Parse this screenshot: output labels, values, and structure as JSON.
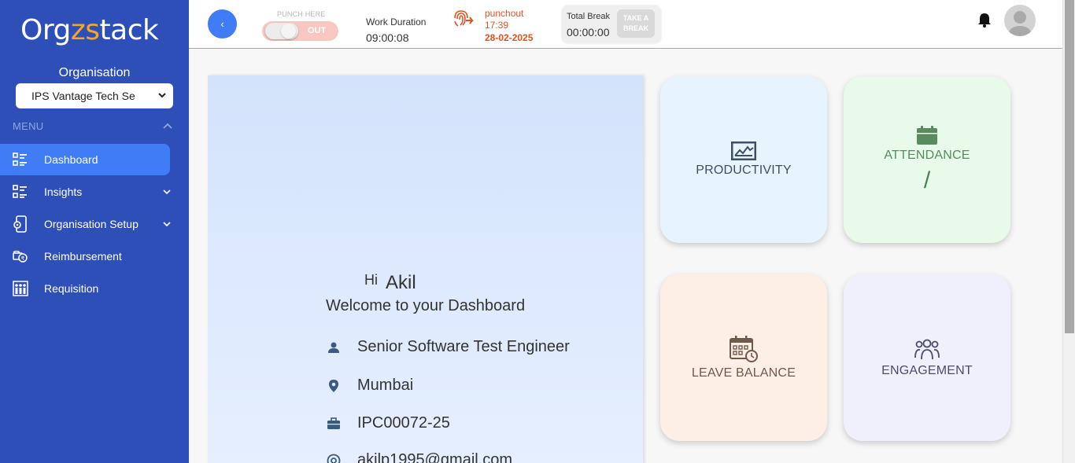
{
  "brand": {
    "logo_pre": "Org",
    "logo_accent": "zs",
    "logo_post": "tack"
  },
  "sidebar": {
    "org_label": "Organisation",
    "org_selected": "IPS Vantage Tech Se",
    "menu_label": "MENU",
    "items": [
      {
        "label": "Dashboard",
        "icon": "dashboard-icon",
        "active": true
      },
      {
        "label": "Insights",
        "icon": "insights-icon",
        "expandable": true
      },
      {
        "label": "Organisation Setup",
        "icon": "org-setup-icon",
        "expandable": true
      },
      {
        "label": "Reimbursement",
        "icon": "reimbursement-icon"
      },
      {
        "label": "Requisition",
        "icon": "requisition-icon"
      }
    ]
  },
  "header": {
    "back_icon": "‹",
    "punch_here_label": "PUNCH HERE",
    "toggle_label": "OUT",
    "work_duration_label": "Work Duration",
    "work_duration_value": "09:00:08",
    "punch_status": "punchout",
    "punch_time": "17:39",
    "punch_date": "28-02-2025",
    "total_break_label": "Total Break",
    "total_break_value": "00:00:00",
    "take_break_label": "TAKE A BREAK"
  },
  "welcome": {
    "hi": "Hi",
    "name": "Akil",
    "message": "Welcome to your Dashboard",
    "designation": "Senior Software Test Engineer",
    "location": "Mumbai",
    "employee_id": "IPC00072-25",
    "email": "akilp1995@gmail.com"
  },
  "tiles": {
    "productivity": "PRODUCTIVITY",
    "attendance": "ATTENDANCE",
    "attendance_value": "/",
    "leave_balance": "LEAVE BALANCE",
    "engagement": "ENGAGEMENT"
  },
  "colors": {
    "sidebar_bg": "#2f4fb8",
    "active_item": "#3f7cf6",
    "punch_accent": "#e0531f",
    "logo_accent": "#f6a623"
  }
}
